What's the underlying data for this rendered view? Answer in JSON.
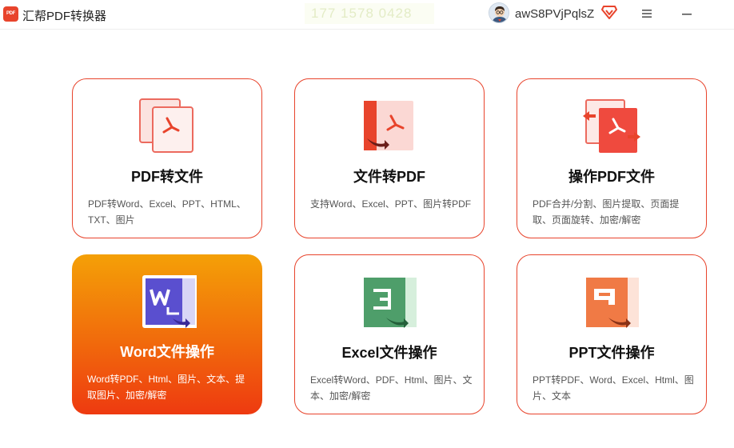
{
  "app": {
    "logo_text": "PDF",
    "title": "汇帮PDF转换器",
    "watermark": "177 1578 0428",
    "username": "awS8PVjPqlsZ"
  },
  "icons": {
    "avatar": "avatar-icon",
    "vip": "vip-diamond-icon",
    "menu": "hamburger-menu-icon",
    "minimize": "minimize-icon"
  },
  "colors": {
    "accent": "#e8442c",
    "active_gradient_top": "#f4a007",
    "active_gradient_bottom": "#ee3a10",
    "excel_green": "#4e9e6a",
    "word_purple": "#5a4fcf",
    "ppt_orange": "#f07a45"
  },
  "cards": [
    {
      "title": "PDF转文件",
      "desc": "PDF转Word、Excel、PPT、HTML、TXT、图片",
      "active": false
    },
    {
      "title": "文件转PDF",
      "desc": "支持Word、Excel、PPT、图片转PDF",
      "active": false
    },
    {
      "title": "操作PDF文件",
      "desc": "PDF合并/分割、图片提取、页面提取、页面旋转、加密/解密",
      "active": false
    },
    {
      "title": "Word文件操作",
      "desc": "Word转PDF、Html、图片、文本、提取图片、加密/解密",
      "active": true
    },
    {
      "title": "Excel文件操作",
      "desc": "Excel转Word、PDF、Html、图片、文本、加密/解密",
      "active": false
    },
    {
      "title": "PPT文件操作",
      "desc": "PPT转PDF、Word、Excel、Html、图片、文本",
      "active": false
    }
  ]
}
